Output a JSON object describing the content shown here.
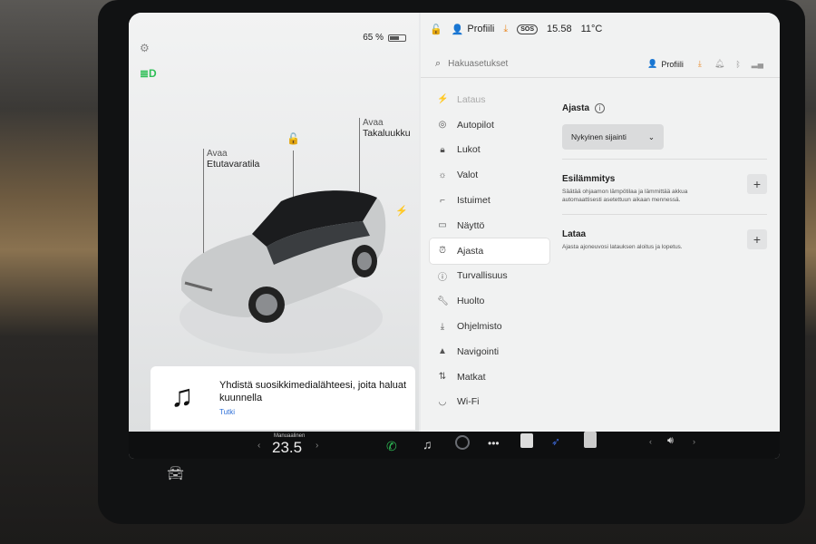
{
  "status": {
    "battery_percent": "65 %",
    "battery_level": 0.65
  },
  "topbar": {
    "profile": "Profiili",
    "sos": "SOS",
    "time": "15.58",
    "temperature": "11°C"
  },
  "search": {
    "placeholder": "Hakuasetukset",
    "profile": "Profiili"
  },
  "car_labels": {
    "front_trunk_action": "Avaa",
    "front_trunk_name": "Etutavaratila",
    "rear_trunk_action": "Avaa",
    "rear_trunk_name": "Takaluukku"
  },
  "menu": {
    "items": [
      {
        "label": "Lataus",
        "icon": "lightning-icon"
      },
      {
        "label": "Autopilot",
        "icon": "steering-wheel-icon"
      },
      {
        "label": "Lukot",
        "icon": "lock-icon"
      },
      {
        "label": "Valot",
        "icon": "sun-icon"
      },
      {
        "label": "Istuimet",
        "icon": "seat-icon"
      },
      {
        "label": "Näyttö",
        "icon": "display-icon"
      },
      {
        "label": "Ajasta",
        "icon": "alarm-clock-icon"
      },
      {
        "label": "Turvallisuus",
        "icon": "info-icon"
      },
      {
        "label": "Huolto",
        "icon": "wrench-icon"
      },
      {
        "label": "Ohjelmisto",
        "icon": "download-icon"
      },
      {
        "label": "Navigointi",
        "icon": "navigation-icon"
      },
      {
        "label": "Matkat",
        "icon": "trip-icon"
      },
      {
        "label": "Wi-Fi",
        "icon": "wifi-icon"
      }
    ],
    "active": "Ajasta"
  },
  "schedule": {
    "title": "Ajasta",
    "dropdown_value": "Nykyinen sijainti",
    "preheat_title": "Esilämmitys",
    "preheat_desc": "Säätää ohjaamon lämpötilaa ja lämmittää akkua automaattisesti asetettuun aikaan mennessä.",
    "charge_title": "Lataa",
    "charge_desc": "Ajasta ajoneuvosi latauksen aloitus ja lopetus."
  },
  "media": {
    "title": "Yhdistä suosikkimedialähteesi, joita haluat kuunnella",
    "link": "Tutki"
  },
  "taskbar": {
    "climate_label": "Manuaalinen",
    "temperature": "23.5"
  },
  "colors": {
    "accent_green": "#2fbf57",
    "link_blue": "#2d6fd8",
    "warning_orange": "#e98b2a"
  }
}
